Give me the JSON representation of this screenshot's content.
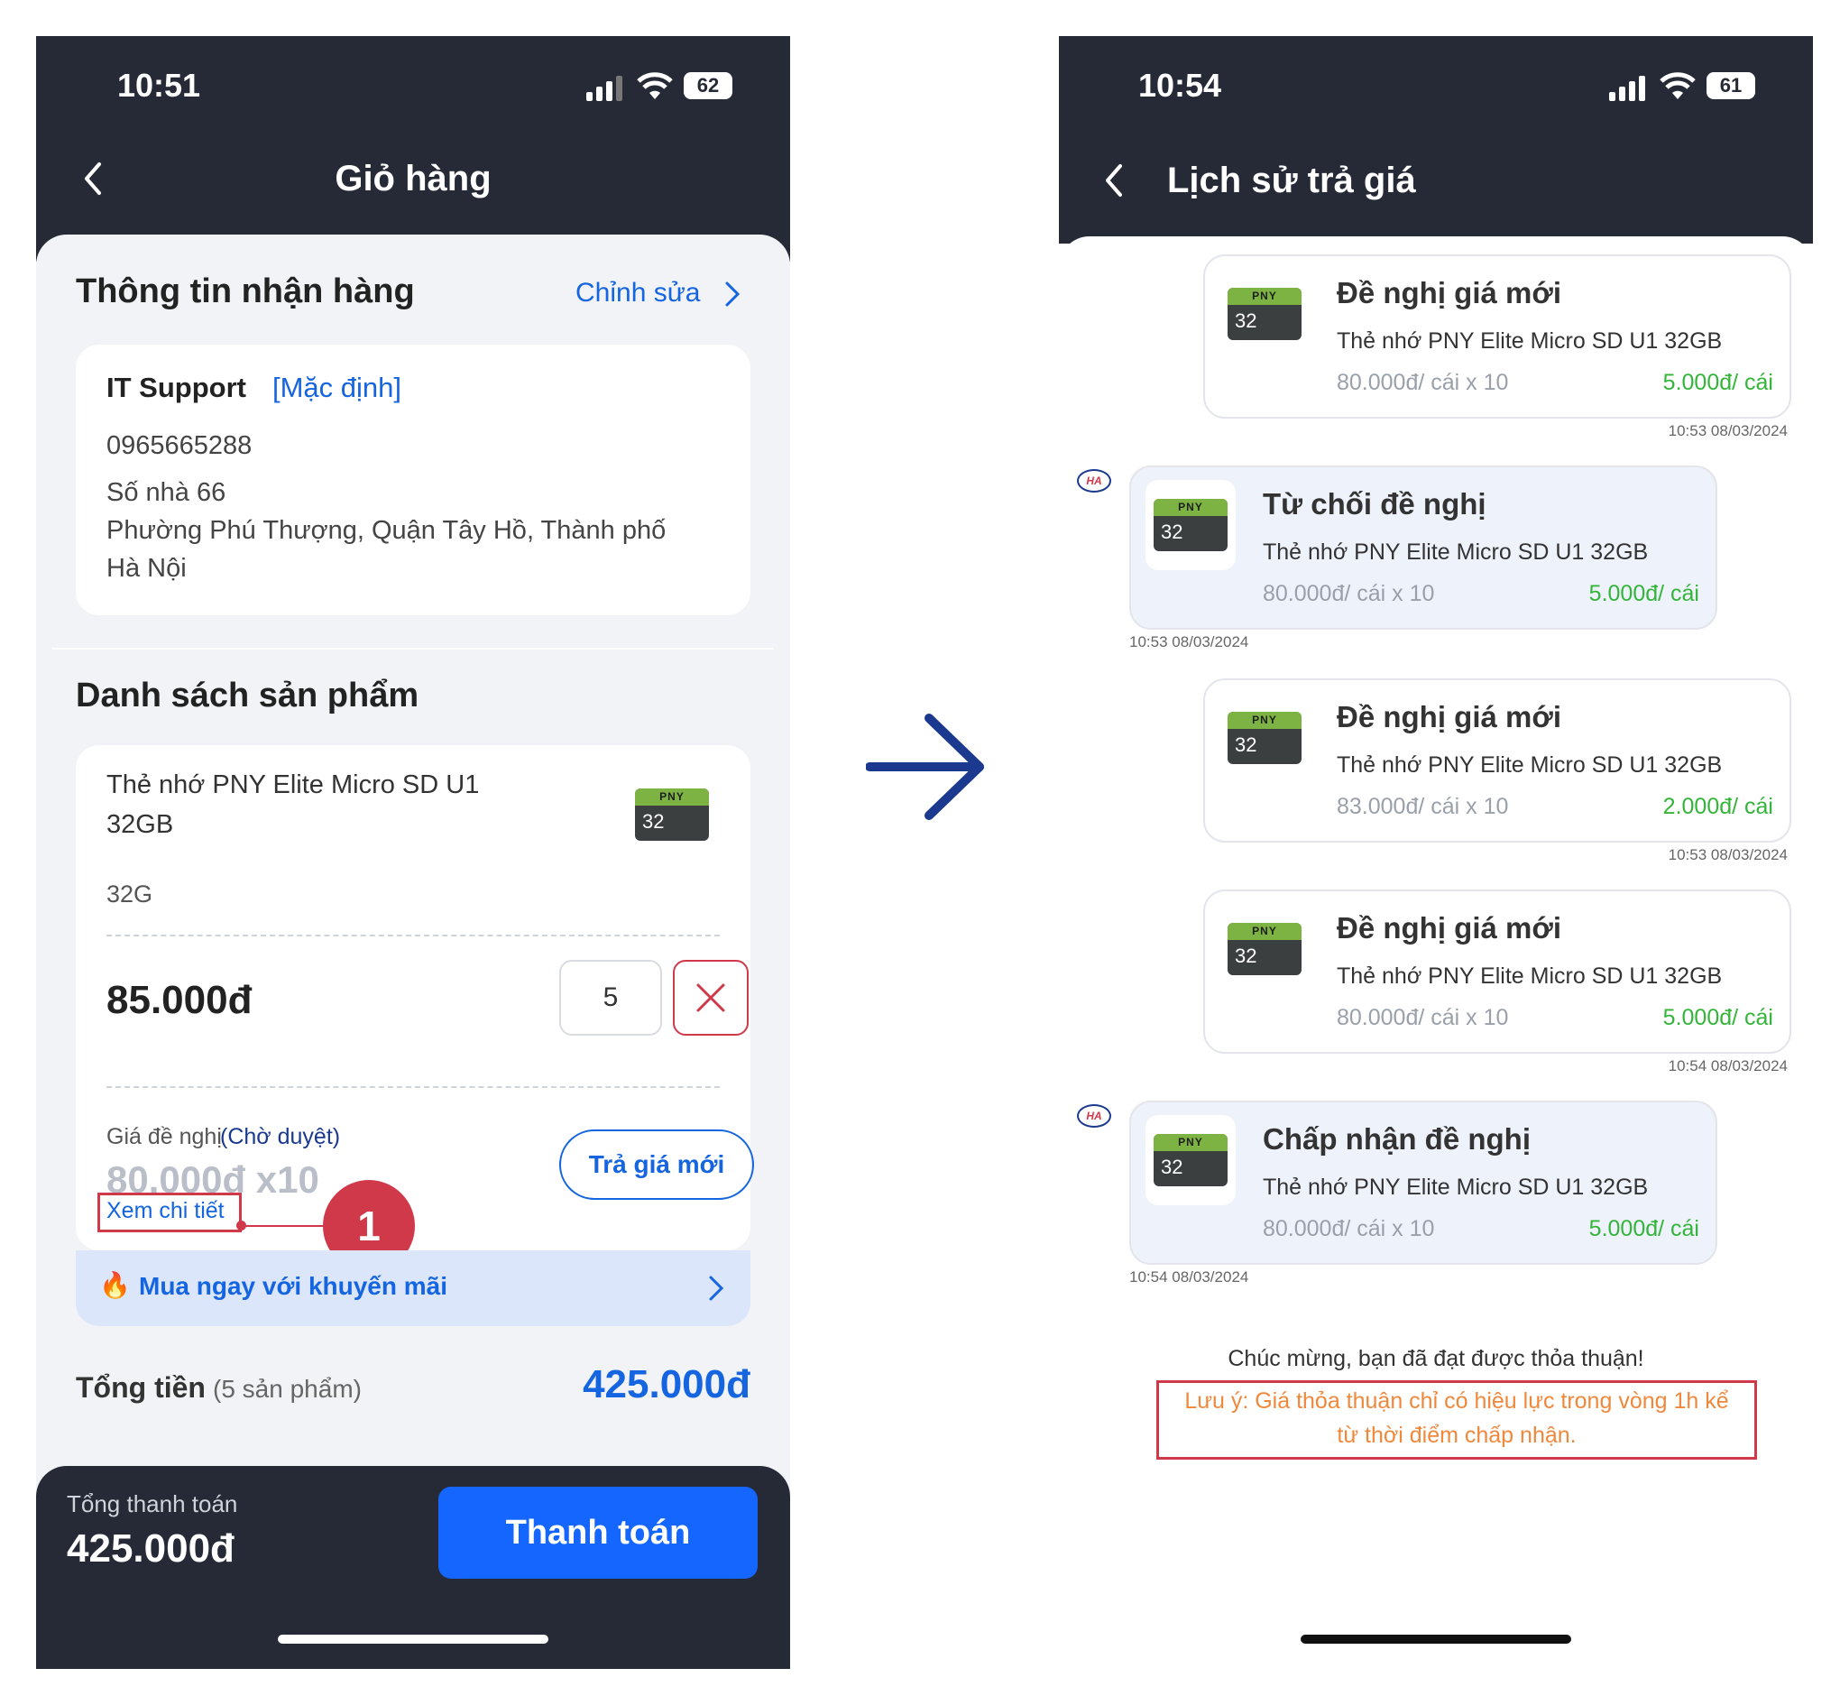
{
  "cart": {
    "status_time": "10:51",
    "battery": "62",
    "title": "Giỏ hàng",
    "receiver": {
      "section_title": "Thông tin nhận hàng",
      "edit_label": "Chỉnh sửa",
      "name": "IT Support",
      "default_tag": "[Mặc định]",
      "phone": "0965665288",
      "address_line1": "Số nhà 66",
      "address_line2": "Phường Phú Thượng, Quận Tây Hồ, Thành phố",
      "address_line3": "Hà Nội"
    },
    "products": {
      "section_title": "Danh sách sản phẩm",
      "item": {
        "name_line1": "Thẻ nhớ PNY Elite Micro SD U1",
        "name_line2": "32GB",
        "variant": "32G",
        "price": "85.000đ",
        "quantity": "5",
        "offer_label": "Giá đề nghị",
        "offer_status": "(Chờ duyệt)",
        "offer_value": "80.000đ x10",
        "detail_link": "Xem chi tiết",
        "new_offer_button": "Trả giá mới",
        "thumb_brand": "PNY",
        "thumb_num": "32"
      },
      "promo_label": "Mua ngay với khuyến mãi",
      "total_label": "Tổng tiền",
      "total_count": "(5 sản phẩm)",
      "total_value": "425.000đ"
    },
    "footer": {
      "pay_total_label": "Tổng thanh toán",
      "pay_total_value": "425.000đ",
      "pay_button": "Thanh toán"
    },
    "callout_number": "1"
  },
  "history": {
    "status_time": "10:54",
    "battery": "61",
    "title": "Lịch sử trả giá",
    "messages": [
      {
        "title": "Đề nghị giá mới",
        "product": "Thẻ nhớ PNY Elite Micro SD U1 32GB",
        "price": "80.000đ/ cái x 10",
        "offer": "5.000đ/ cái",
        "time": "10:53 08/03/2024"
      },
      {
        "title": "Từ chối đề nghị",
        "product": "Thẻ nhớ PNY Elite Micro SD U1 32GB",
        "price": "80.000đ/ cái x 10",
        "offer": "5.000đ/ cái",
        "time": "10:53 08/03/2024"
      },
      {
        "title": "Đề nghị giá mới",
        "product": "Thẻ nhớ PNY Elite Micro SD U1 32GB",
        "price": "83.000đ/ cái x 10",
        "offer": "2.000đ/ cái",
        "time": "10:53 08/03/2024"
      },
      {
        "title": "Đề nghị giá mới",
        "product": "Thẻ nhớ PNY Elite Micro SD U1 32GB",
        "price": "80.000đ/ cái x 10",
        "offer": "5.000đ/ cái",
        "time": "10:54 08/03/2024"
      },
      {
        "title": "Chấp nhận đề nghị",
        "product": "Thẻ nhớ PNY Elite Micro SD U1 32GB",
        "price": "80.000đ/ cái x 10",
        "offer": "5.000đ/ cái",
        "time": "10:54 08/03/2024"
      }
    ],
    "shop_avatar": "HA",
    "thumb_brand": "PNY",
    "thumb_num": "32",
    "congrats": "Chúc mừng, bạn đã đạt được thỏa thuận!",
    "note_line1": "Lưu ý: Giá thỏa thuận chỉ có hiệu lực trong vòng 1h kể",
    "note_line2": "từ thời điểm chấp nhận."
  },
  "colors": {
    "dark_bar": "#262a36",
    "accent_blue": "#1565e0",
    "pay_blue": "#1466ff",
    "offer_green": "#34b53a",
    "callout_red": "#d0394a",
    "note_orange": "#f0883c",
    "arrow_navy": "#1b3a8f"
  }
}
